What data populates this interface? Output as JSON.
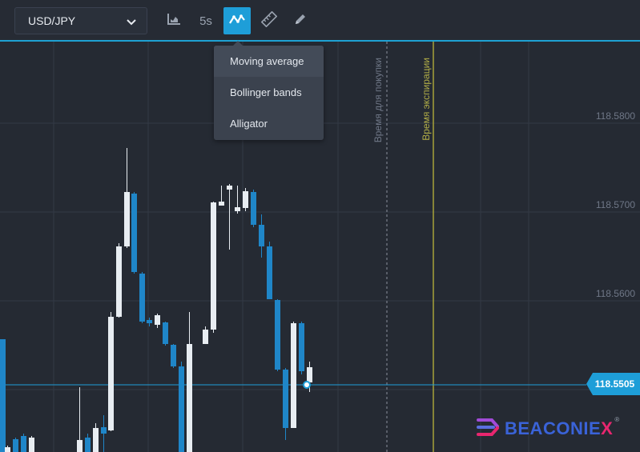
{
  "toolbar": {
    "symbol": "USD/JPY",
    "timeframe_label": "5s",
    "active_tool": "indicators"
  },
  "indicators_menu": {
    "items": [
      "Moving average",
      "Bollinger bands",
      "Alligator"
    ],
    "highlighted": "Moving average"
  },
  "chart": {
    "price_levels": [
      "118.5800",
      "118.5700",
      "118.5600"
    ],
    "current_price": "118.5505",
    "purchase_time_label": "Время для покупки",
    "expiration_time_label": "Время экспирации"
  },
  "brand": {
    "name_main": "BEACONIE",
    "name_accent": "X",
    "registered": "®",
    "primary_color": "#3a63d8",
    "accent_color": "#e8266f"
  },
  "colors": {
    "bull_candle": "#e8edf2",
    "bear_candle": "#1f86c8",
    "accent": "#1e9ed8",
    "expiration_line": "#a6a23a"
  }
}
